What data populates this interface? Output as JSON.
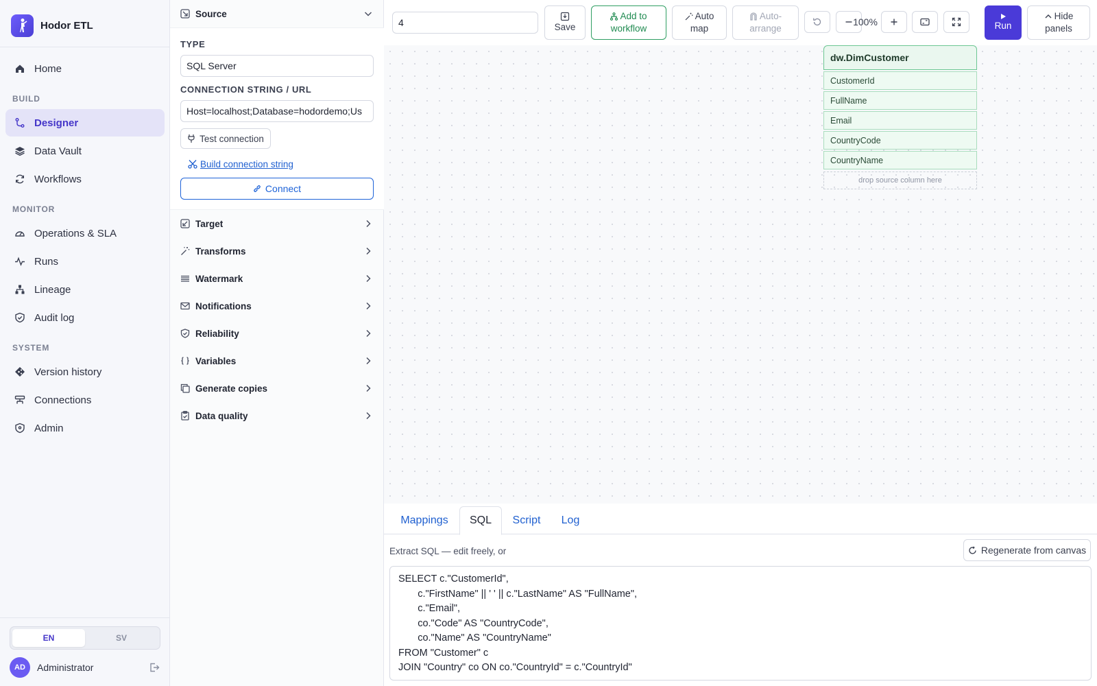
{
  "app": {
    "name": "Hodor ETL"
  },
  "sidebar": {
    "home": "Home",
    "sections": {
      "build": "BUILD",
      "monitor": "MONITOR",
      "system": "SYSTEM"
    },
    "build_items": [
      "Designer",
      "Data Vault",
      "Workflows"
    ],
    "monitor_items": [
      "Operations & SLA",
      "Runs",
      "Lineage",
      "Audit log"
    ],
    "system_items": [
      "Version history",
      "Connections",
      "Admin"
    ],
    "active": "Designer",
    "languages": [
      "EN",
      "SV"
    ],
    "active_language": "EN",
    "user": {
      "initials": "AD",
      "name": "Administrator"
    }
  },
  "panel": {
    "source": {
      "title": "Source",
      "type_label": "TYPE",
      "type_value": "SQL Server",
      "conn_label": "CONNECTION STRING / URL",
      "conn_value": "Host=localhost;Database=hodordemo;Us",
      "test_button": "Test connection",
      "build_link": "Build connection string",
      "connect_button": "Connect"
    },
    "sections": [
      "Target",
      "Transforms",
      "Watermark",
      "Notifications",
      "Reliability",
      "Variables",
      "Generate copies",
      "Data quality"
    ]
  },
  "toolbar": {
    "step_value": "4",
    "save": "Save",
    "add_to_workflow": [
      "Add to",
      "workflow"
    ],
    "auto_map": [
      "Auto",
      "map"
    ],
    "auto_arrange": [
      "Auto-",
      "arrange"
    ],
    "zoom": "100%",
    "run": "Run",
    "hide_panels": [
      "Hide",
      "panels"
    ]
  },
  "canvas": {
    "node": {
      "title": "dw.DimCustomer",
      "columns": [
        "CustomerId",
        "FullName",
        "Email",
        "CountryCode",
        "CountryName"
      ],
      "drop_hint": "drop source column here"
    }
  },
  "bottom": {
    "tabs": [
      "Mappings",
      "SQL",
      "Script",
      "Log"
    ],
    "active_tab": "SQL",
    "hint": "Extract SQL — edit freely, or",
    "regenerate": "Regenerate from canvas",
    "sql": "SELECT c.\"CustomerId\",\n       c.\"FirstName\" || ' ' || c.\"LastName\" AS \"FullName\",\n       c.\"Email\",\n       co.\"Code\" AS \"CountryCode\",\n       co.\"Name\" AS \"CountryName\"\nFROM \"Customer\" c\nJOIN \"Country\" co ON co.\"CountryId\" = c.\"CountryId\""
  }
}
